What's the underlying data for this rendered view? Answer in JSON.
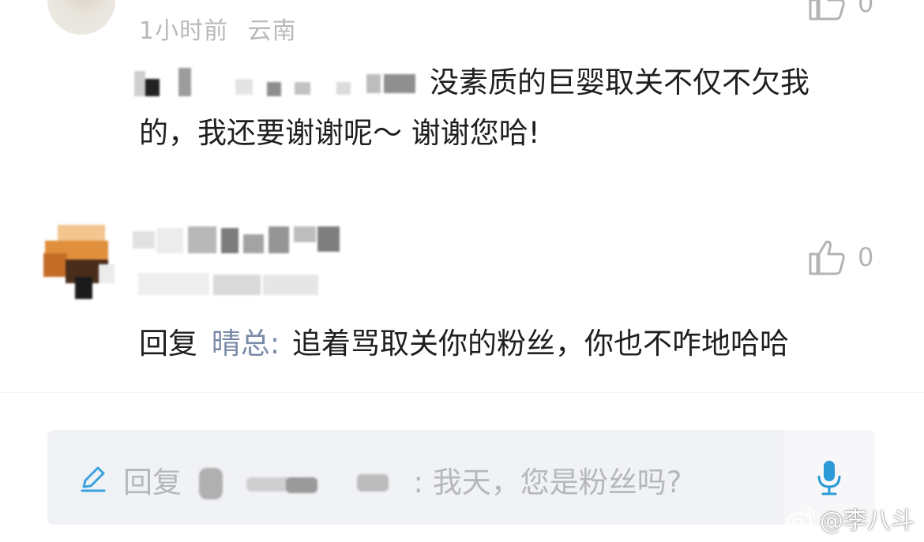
{
  "comments": [
    {
      "time": "1小时前",
      "location": "云南",
      "text_line1": "没素质的巨婴取关不仅不欠我",
      "text_line2": "的，我还要谢谢呢～ 谢谢您哈!",
      "like_count": "0"
    },
    {
      "reply_prefix": "回复",
      "reply_to": "晴总",
      "colon": ":",
      "text": "追着骂取关你的粉丝，你也不咋地哈哈",
      "like_count": "0"
    }
  ],
  "reply_box": {
    "prefix": "回复",
    "text": ": 我天，您是粉丝吗?"
  },
  "watermark": "@李八斗",
  "icons": {
    "like": "thumbs-up-icon",
    "edit": "pencil-icon",
    "mic": "microphone-icon",
    "weibo": "weibo-logo-icon"
  },
  "colors": {
    "meta_gray": "#b9b9b9",
    "reply_name": "#7a8ba8",
    "mic_blue": "#2b9ad6",
    "input_bg": "#f1f2f6"
  }
}
